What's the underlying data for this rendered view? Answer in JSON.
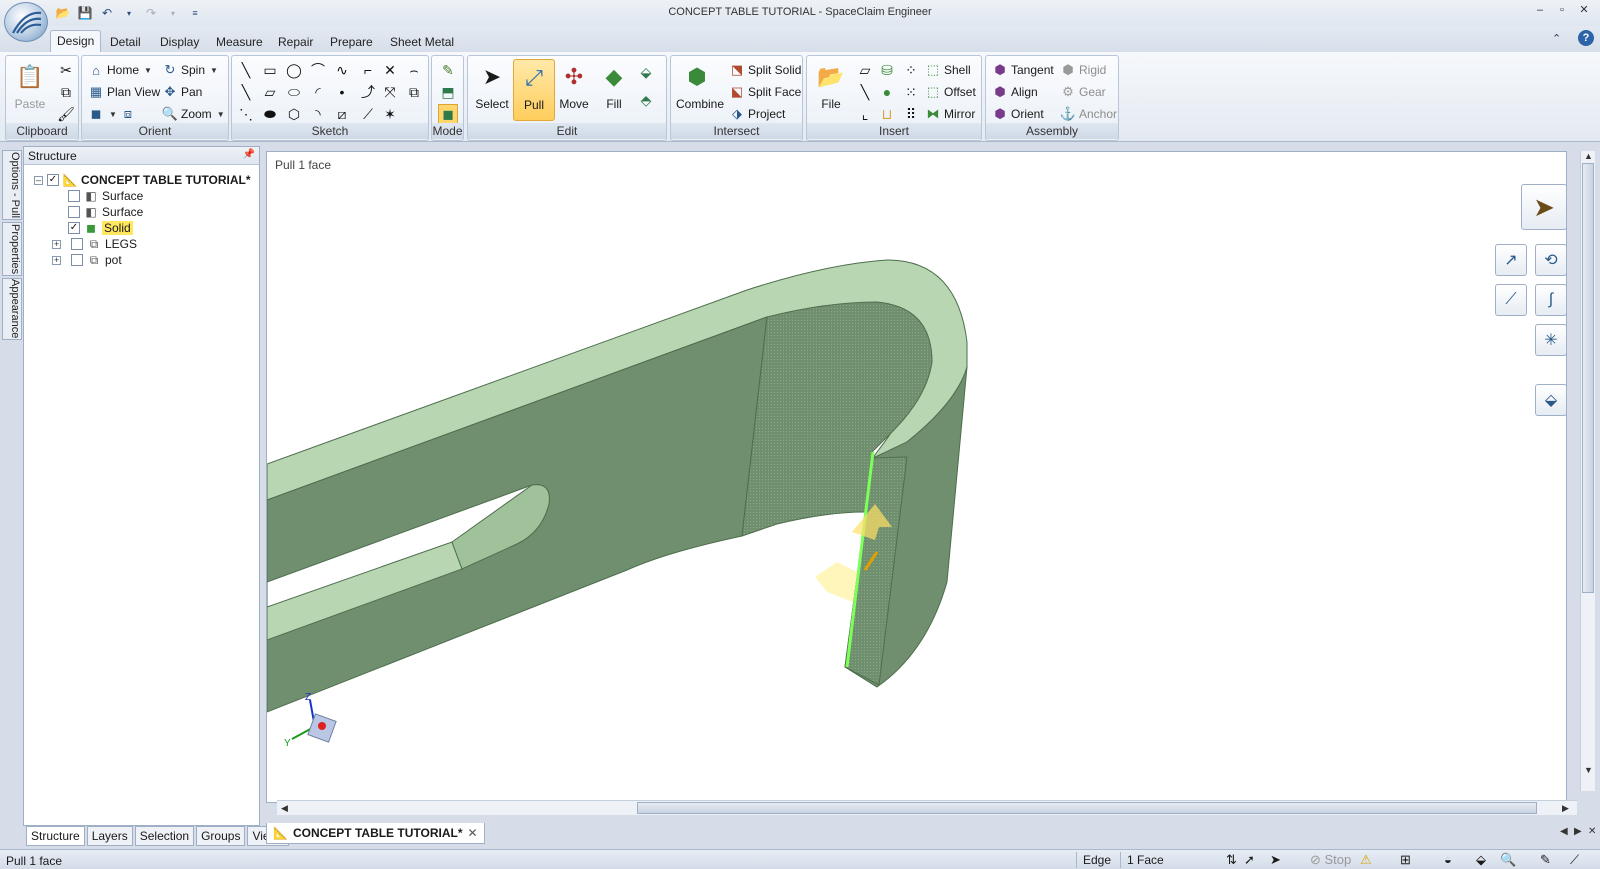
{
  "window": {
    "title": "CONCEPT TABLE TUTORIAL - SpaceClaim Engineer",
    "controls": {
      "minimize": "–",
      "restore": "▫",
      "close": "✕"
    }
  },
  "tabs": [
    "Design",
    "Detail",
    "Display",
    "Measure",
    "Repair",
    "Prepare",
    "Sheet Metal"
  ],
  "active_tab": "Design",
  "ribbon": {
    "clipboard": {
      "label": "Clipboard",
      "paste": "Paste"
    },
    "orient": {
      "label": "Orient",
      "home": "Home",
      "plan_view": "Plan View",
      "spin": "Spin",
      "pan": "Pan",
      "zoom": "Zoom"
    },
    "sketch": {
      "label": "Sketch"
    },
    "mode": {
      "label": "Mode"
    },
    "edit": {
      "label": "Edit",
      "select": "Select",
      "pull": "Pull",
      "move": "Move",
      "fill": "Fill"
    },
    "intersect": {
      "label": "Intersect",
      "combine": "Combine",
      "split_solid": "Split Solid",
      "split_face": "Split Face",
      "project": "Project"
    },
    "insert": {
      "label": "Insert",
      "file": "File",
      "shell": "Shell",
      "offset": "Offset",
      "mirror": "Mirror"
    },
    "assembly": {
      "label": "Assembly",
      "tangent": "Tangent",
      "align": "Align",
      "orient": "Orient",
      "rigid": "Rigid",
      "gear": "Gear",
      "anchor": "Anchor"
    }
  },
  "side_tabs": [
    "Options - Pull",
    "Properties",
    "Appearance"
  ],
  "structure": {
    "title": "Structure",
    "root": "CONCEPT TABLE TUTORIAL*",
    "items": [
      {
        "label": "Surface",
        "checked": false
      },
      {
        "label": "Surface",
        "checked": false
      },
      {
        "label": "Solid",
        "checked": true
      },
      {
        "label": "LEGS",
        "checked": false
      },
      {
        "label": "pot",
        "checked": false
      }
    ],
    "tabs": [
      "Structure",
      "Layers",
      "Selection",
      "Groups",
      "Views"
    ]
  },
  "viewport": {
    "status": "Pull 1 face"
  },
  "document_tab": "CONCEPT TABLE TUTORIAL*",
  "statusbar": {
    "message": "Pull 1 face",
    "filter": "Edge",
    "selection": "1 Face",
    "stop": "Stop"
  },
  "colors": {
    "model_face": "#6f8f6e",
    "model_top": "#b7d6b1",
    "selected_edge": "#7dff5a",
    "accent": "#ffcd5c"
  }
}
